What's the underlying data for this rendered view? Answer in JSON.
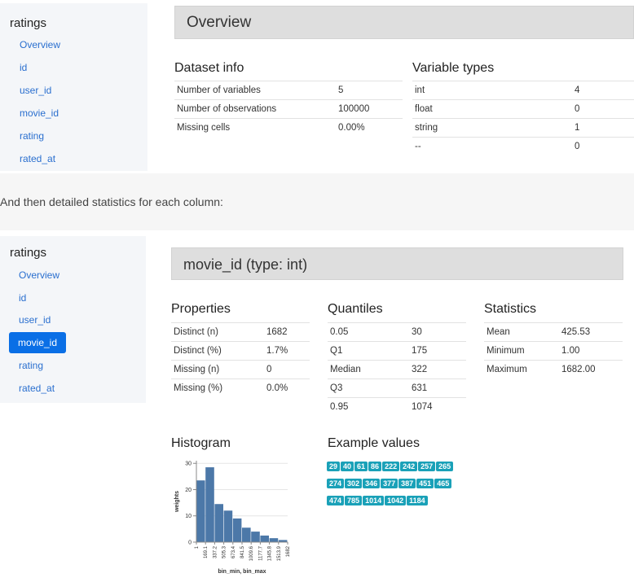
{
  "overview": {
    "nav": {
      "title": "ratings",
      "items": [
        "Overview",
        "id",
        "user_id",
        "movie_id",
        "rating",
        "rated_at"
      ]
    },
    "banner": "Overview",
    "dataset_info": {
      "title": "Dataset info",
      "rows": [
        [
          "Number of variables",
          "5"
        ],
        [
          "Number of observations",
          "100000"
        ],
        [
          "Missing cells",
          "0.00%"
        ]
      ]
    },
    "variable_types": {
      "title": "Variable types",
      "rows": [
        [
          "int",
          "4"
        ],
        [
          "float",
          "0"
        ],
        [
          "string",
          "1"
        ],
        [
          "--",
          "0"
        ]
      ]
    }
  },
  "caption": "And then detailed statistics for each column:",
  "detail": {
    "nav": {
      "title": "ratings",
      "items": [
        "Overview",
        "id",
        "user_id",
        "movie_id",
        "rating",
        "rated_at"
      ],
      "active": "movie_id"
    },
    "banner": "movie_id (type: int)",
    "properties": {
      "title": "Properties",
      "rows": [
        [
          "Distinct (n)",
          "1682"
        ],
        [
          "Distinct (%)",
          "1.7%"
        ],
        [
          "Missing (n)",
          "0"
        ],
        [
          "Missing (%)",
          "0.0%"
        ]
      ]
    },
    "quantiles": {
      "title": "Quantiles",
      "rows": [
        [
          "0.05",
          "30"
        ],
        [
          "Q1",
          "175"
        ],
        [
          "Median",
          "322"
        ],
        [
          "Q3",
          "631"
        ],
        [
          "0.95",
          "1074"
        ]
      ]
    },
    "statistics": {
      "title": "Statistics",
      "rows": [
        [
          "Mean",
          "425.53"
        ],
        [
          "Minimum",
          "1.00"
        ],
        [
          "Maximum",
          "1682.00"
        ]
      ]
    },
    "histogram_title": "Histogram",
    "example_values_title": "Example values",
    "example_values": [
      "29",
      "40",
      "61",
      "86",
      "222",
      "242",
      "257",
      "265",
      "274",
      "302",
      "346",
      "377",
      "387",
      "451",
      "465",
      "474",
      "785",
      "1014",
      "1042",
      "1184"
    ],
    "bar_color": "#4c78a8",
    "chip_color": "#1aa1b8"
  },
  "chart_data": {
    "type": "bar",
    "xlabel": "bin_min, bin_max",
    "ylabel": "weights",
    "categories": [
      "1",
      "169.1",
      "337.2",
      "505.3",
      "673.4",
      "841.5",
      "1009.6",
      "1177.7",
      "1345.8",
      "1513.9",
      "1682"
    ],
    "values": [
      23.5,
      28.5,
      14.5,
      12,
      9,
      5.5,
      4,
      2.5,
      1.5,
      0.8
    ],
    "yticks": [
      0,
      10,
      20,
      30
    ],
    "ylim": [
      0,
      31
    ],
    "grid": true
  }
}
